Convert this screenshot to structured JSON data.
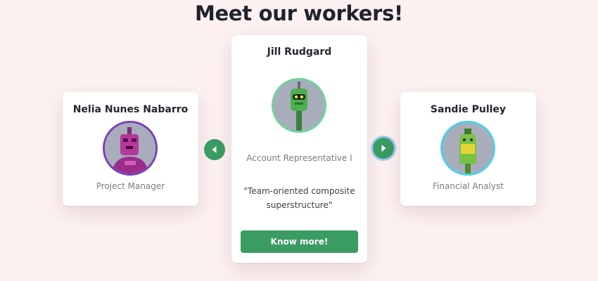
{
  "page": {
    "title": "Meet our workers!"
  },
  "carousel": {
    "prev_icon": "caret-left-icon",
    "next_icon": "caret-right-icon",
    "cards": [
      {
        "name": "Nelia Nunes Nabarro",
        "role": "Project Manager",
        "avatar_color": "#7a3fb8"
      },
      {
        "name": "Jill Rudgard",
        "role": "Account Representative I",
        "quote": "\"Team-oriented composite superstructure\"",
        "button_label": "Know more!",
        "avatar_color": "#6fd39a"
      },
      {
        "name": "Sandie Pulley",
        "role": "Financial Analyst",
        "avatar_color": "#4bd0ea"
      }
    ]
  },
  "colors": {
    "accent": "#3a9b63",
    "background": "#fdf1f1"
  }
}
